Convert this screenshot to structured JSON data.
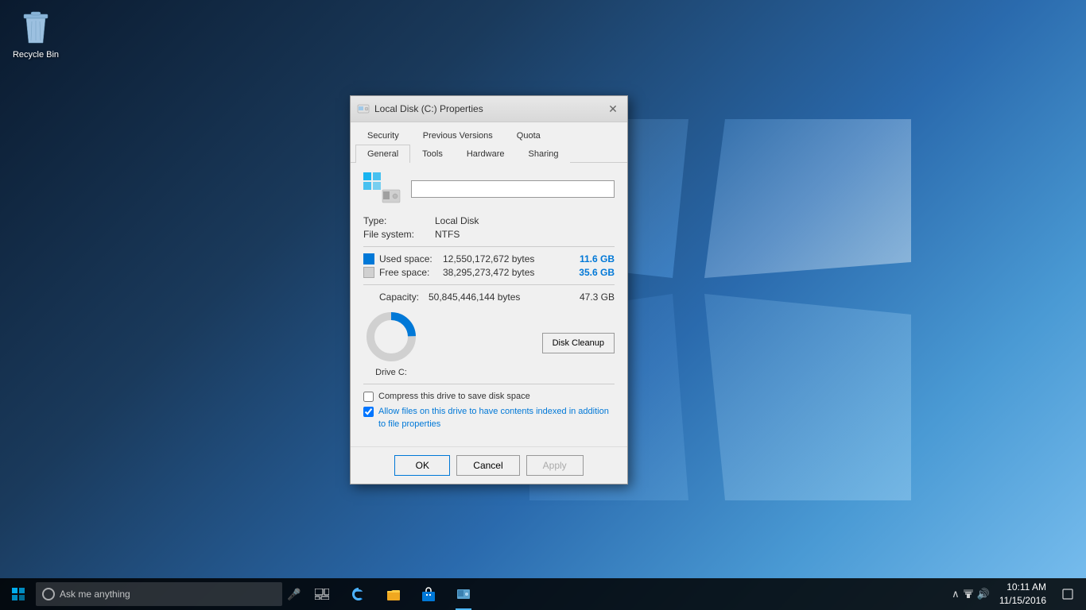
{
  "desktop": {
    "background_desc": "Windows 10 dark blue with light beams"
  },
  "recycle_bin": {
    "label": "Recycle Bin"
  },
  "dialog": {
    "title": "Local Disk (C:) Properties",
    "tabs_row1": [
      {
        "id": "general",
        "label": "General",
        "active": true
      },
      {
        "id": "tools",
        "label": "Tools"
      },
      {
        "id": "hardware",
        "label": "Hardware"
      },
      {
        "id": "sharing",
        "label": "Sharing"
      }
    ],
    "tabs_row2": [
      {
        "id": "security",
        "label": "Security"
      },
      {
        "id": "previous_versions",
        "label": "Previous Versions"
      },
      {
        "id": "quota",
        "label": "Quota"
      }
    ],
    "drive_name_placeholder": "",
    "type_label": "Type:",
    "type_value": "Local Disk",
    "filesystem_label": "File system:",
    "filesystem_value": "NTFS",
    "used_space_label": "Used space:",
    "used_space_bytes": "12,550,172,672 bytes",
    "used_space_gb": "11.6 GB",
    "free_space_label": "Free space:",
    "free_space_bytes": "38,295,273,472 bytes",
    "free_space_gb": "35.6 GB",
    "capacity_label": "Capacity:",
    "capacity_bytes": "50,845,446,144 bytes",
    "capacity_gb": "47.3 GB",
    "drive_label": "Drive C:",
    "disk_cleanup_btn": "Disk Cleanup",
    "compress_label": "Compress this drive to save disk space",
    "index_label": "Allow files on this drive to have contents indexed in addition to file properties",
    "compress_checked": false,
    "index_checked": true,
    "ok_btn": "OK",
    "cancel_btn": "Cancel",
    "apply_btn": "Apply",
    "donut": {
      "used_percent": 24.7,
      "free_percent": 75.3,
      "used_color": "#0078d7",
      "free_color": "#d0d0d0"
    }
  },
  "taskbar": {
    "search_placeholder": "Ask me anything",
    "time": "10:11 AM",
    "date": "11/15/2016",
    "start_icon": "⊞",
    "apps": [
      {
        "id": "edge",
        "label": "Microsoft Edge",
        "symbol": "e"
      },
      {
        "id": "explorer",
        "label": "File Explorer",
        "symbol": "📁"
      },
      {
        "id": "store",
        "label": "Store",
        "symbol": "🛍"
      },
      {
        "id": "disk-mgmt",
        "label": "Disk Management",
        "symbol": "💿"
      }
    ]
  }
}
